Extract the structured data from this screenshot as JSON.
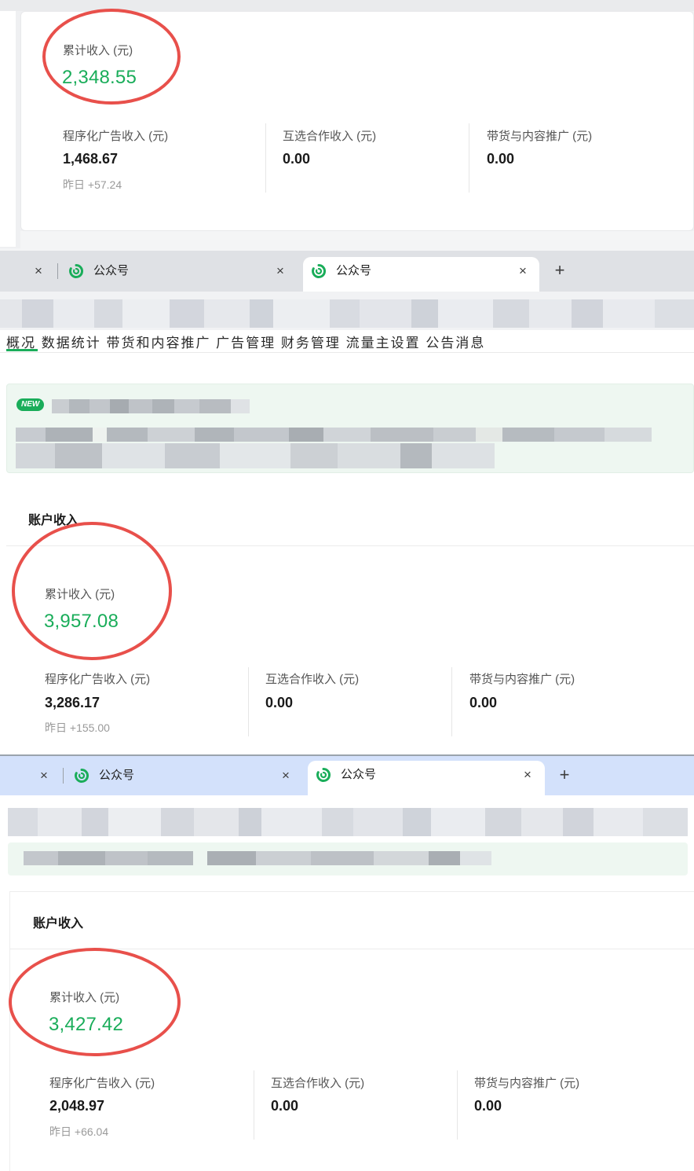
{
  "panels": [
    {
      "total_label": "累计收入 (元)",
      "total_value": "2,348.55",
      "programmatic_label": "程序化广告收入 (元)",
      "programmatic_value": "1,468.67",
      "programmatic_yesterday": "昨日 +57.24",
      "mutual_label": "互选合作收入 (元)",
      "mutual_value": "0.00",
      "goods_label": "带货与内容推广 (元)",
      "goods_value": "0.00"
    },
    {
      "section_title": "账户收入",
      "total_label": "累计收入 (元)",
      "total_value": "3,957.08",
      "programmatic_label": "程序化广告收入 (元)",
      "programmatic_value": "3,286.17",
      "programmatic_yesterday": "昨日 +155.00",
      "mutual_label": "互选合作收入 (元)",
      "mutual_value": "0.00",
      "goods_label": "带货与内容推广 (元)",
      "goods_value": "0.00"
    },
    {
      "section_title": "账户收入",
      "total_label": "累计收入 (元)",
      "total_value": "3,427.42",
      "programmatic_label": "程序化广告收入 (元)",
      "programmatic_value": "2,048.97",
      "programmatic_yesterday": "昨日 +66.04",
      "mutual_label": "互选合作收入 (元)",
      "mutual_value": "0.00",
      "goods_label": "带货与内容推广 (元)",
      "goods_value": "0.00"
    }
  ],
  "tabbars": [
    {
      "tab1_title": "公众号",
      "tab2_title": "公众号",
      "close_glyph": "×",
      "new_tab_glyph": "+"
    },
    {
      "tab1_title": "公众号",
      "tab2_title": "公众号",
      "close_glyph": "×",
      "new_tab_glyph": "+"
    }
  ],
  "nav_partial": "概况   数据统计   带货和内容推广   广告管理   财务管理   流量主设置   公告消息",
  "new_badge": "NEW",
  "colors": {
    "accent_green": "#1aad5a",
    "highlight_ring": "#e8504b",
    "tabbar_gray": "#dfe1e5",
    "tabbar_blue": "#d3e1fb"
  }
}
